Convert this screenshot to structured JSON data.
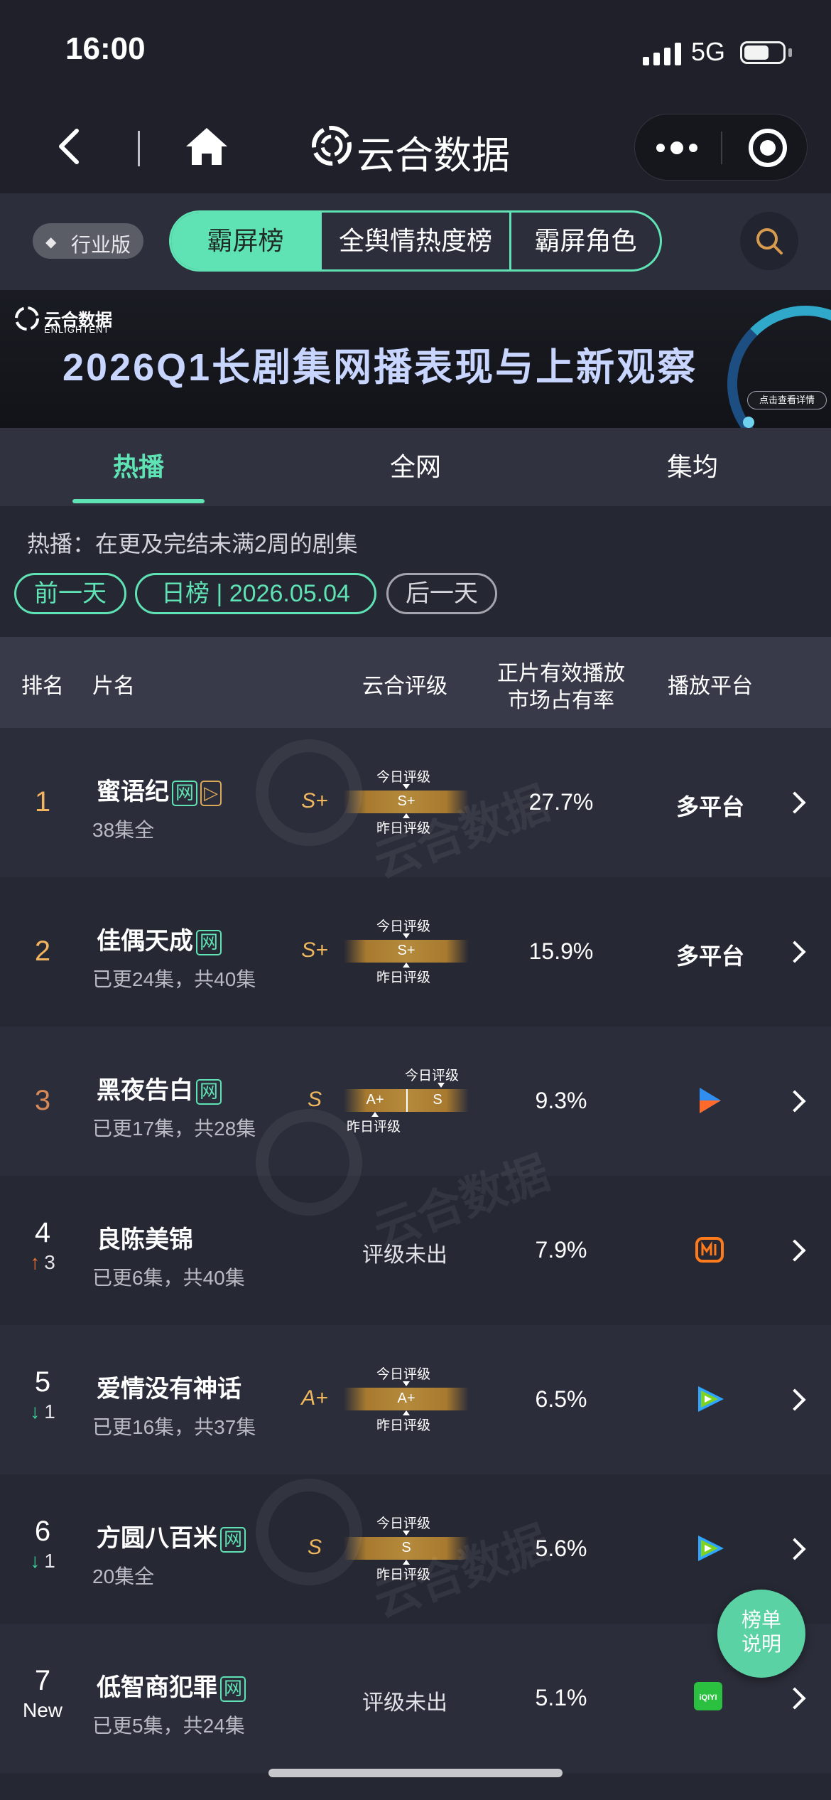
{
  "status_bar": {
    "time": "16:00",
    "network": "5G"
  },
  "nav": {
    "title": "云合数据"
  },
  "filter": {
    "edition": "行业版",
    "tabs": [
      "霸屏榜",
      "全舆情热度榜",
      "霸屏角色"
    ],
    "active_tab": 0
  },
  "banner": {
    "logo": "云合数据",
    "logo_sub": "ENLIGHTENT",
    "title": "2026Q1长剧集网播表现与上新观察",
    "cta": "点击查看详情"
  },
  "subtabs": [
    "热播",
    "全网",
    "集均"
  ],
  "note": "热播：在更及完结未满2周的剧集",
  "date_nav": {
    "prev": "前一天",
    "current": "日榜 | 2026.05.04",
    "next": "后一天"
  },
  "table_header": {
    "rank": "排名",
    "title": "片名",
    "rating": "云合评级",
    "share_line1": "正片有效播放",
    "share_line2": "市场占有率",
    "platform": "播放平台"
  },
  "rating_labels": {
    "today": "今日评级",
    "yesterday": "昨日评级",
    "none": "评级未出"
  },
  "rows": [
    {
      "rank": "1",
      "trend": "",
      "trend_num": "",
      "title": "蜜语纪",
      "tags": [
        "网",
        "▷"
      ],
      "episodes": "38集全",
      "grade": "S+",
      "bar_today": "S+",
      "bar_yesterday": "",
      "share": "27.7%",
      "platform": "多平台",
      "platform_icon": ""
    },
    {
      "rank": "2",
      "trend": "",
      "trend_num": "",
      "title": "佳偶天成",
      "tags": [
        "网"
      ],
      "episodes": "已更24集，共40集",
      "grade": "S+",
      "bar_today": "S+",
      "bar_yesterday": "",
      "share": "15.9%",
      "platform": "多平台",
      "platform_icon": ""
    },
    {
      "rank": "3",
      "trend": "",
      "trend_num": "",
      "title": "黑夜告白",
      "tags": [
        "网"
      ],
      "episodes": "已更17集，共28集",
      "grade": "S",
      "bar_today": "S",
      "bar_yesterday": "A+",
      "share": "9.3%",
      "platform": "",
      "platform_icon": "youku-icon"
    },
    {
      "rank": "4",
      "trend": "up",
      "trend_num": "3",
      "title": "良陈美锦",
      "tags": [],
      "episodes": "已更6集，共40集",
      "grade": "",
      "bar_today": "",
      "bar_yesterday": "",
      "share": "7.9%",
      "platform": "",
      "platform_icon": "mgtv-icon"
    },
    {
      "rank": "5",
      "trend": "down",
      "trend_num": "1",
      "title": "爱情没有神话",
      "tags": [],
      "episodes": "已更16集，共37集",
      "grade": "A+",
      "bar_today": "A+",
      "bar_yesterday": "",
      "share": "6.5%",
      "platform": "",
      "platform_icon": "tencent-video-icon"
    },
    {
      "rank": "6",
      "trend": "down",
      "trend_num": "1",
      "title": "方圆八百米",
      "tags": [
        "网"
      ],
      "episodes": "20集全",
      "grade": "S",
      "bar_today": "S",
      "bar_yesterday": "",
      "share": "5.6%",
      "platform": "",
      "platform_icon": "tencent-video-icon"
    },
    {
      "rank": "7",
      "trend": "new",
      "trend_num": "New",
      "title": "低智商犯罪",
      "tags": [
        "网"
      ],
      "episodes": "已更5集，共24集",
      "grade": "",
      "bar_today": "",
      "bar_yesterday": "",
      "share": "5.1%",
      "platform": "",
      "platform_icon": "iqiyi-icon"
    }
  ],
  "fab": {
    "line1": "榜单",
    "line2": "说明"
  },
  "colors": {
    "accent": "#5fe3b4",
    "gold": "#f0b75d",
    "up": "#e8743a",
    "down": "#3fd19a"
  }
}
